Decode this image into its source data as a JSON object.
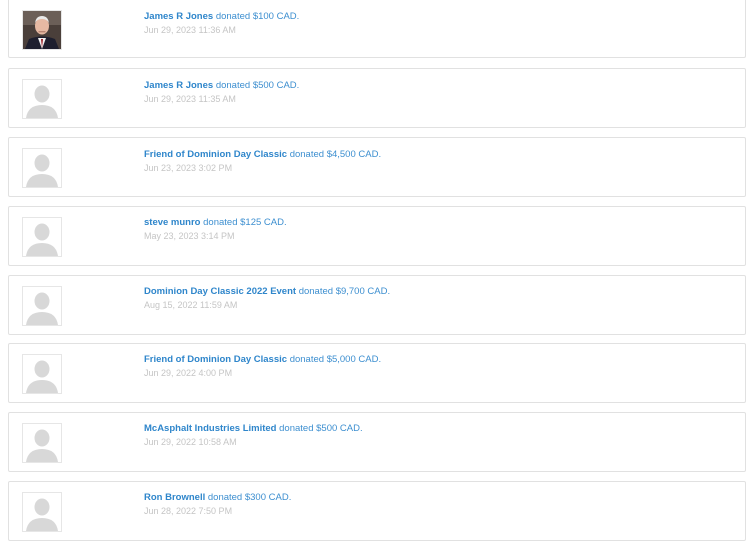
{
  "donations": [
    {
      "name": "James R Jones",
      "verb": "donated",
      "amount": "$100 CAD.",
      "date": "Jun 29, 2023 11:36 AM",
      "avatar": "photo"
    },
    {
      "name": "James R Jones",
      "verb": "donated",
      "amount": "$500 CAD.",
      "date": "Jun 29, 2023 11:35 AM",
      "avatar": "default-user-icon"
    },
    {
      "name": "Friend of Dominion Day Classic",
      "verb": "donated",
      "amount": "$4,500 CAD.",
      "date": "Jun 23, 2023 3:02 PM",
      "avatar": "default-user-icon"
    },
    {
      "name": "steve munro",
      "verb": "donated",
      "amount": "$125 CAD.",
      "date": "May 23, 2023 3:14 PM",
      "avatar": "default-user-icon"
    },
    {
      "name": "Dominion Day Classic 2022 Event",
      "verb": "donated",
      "amount": "$9,700 CAD.",
      "date": "Aug 15, 2022 11:59 AM",
      "avatar": "default-user-icon"
    },
    {
      "name": "Friend of Dominion Day Classic",
      "verb": "donated",
      "amount": "$5,000 CAD.",
      "date": "Jun 29, 2022 4:00 PM",
      "avatar": "default-user-icon"
    },
    {
      "name": "McAsphalt Industries Limited",
      "verb": "donated",
      "amount": "$500 CAD.",
      "date": "Jun 29, 2022 10:58 AM",
      "avatar": "default-user-icon"
    },
    {
      "name": "Ron Brownell",
      "verb": "donated",
      "amount": "$300 CAD.",
      "date": "Jun 28, 2022 7:50 PM",
      "avatar": "default-user-icon"
    }
  ],
  "colors": {
    "link": "#2f86cb",
    "text": "#3d8fd0",
    "date": "#c5c5c5",
    "border": "#e1e1e1",
    "placeholder": "#d8d8d8"
  }
}
